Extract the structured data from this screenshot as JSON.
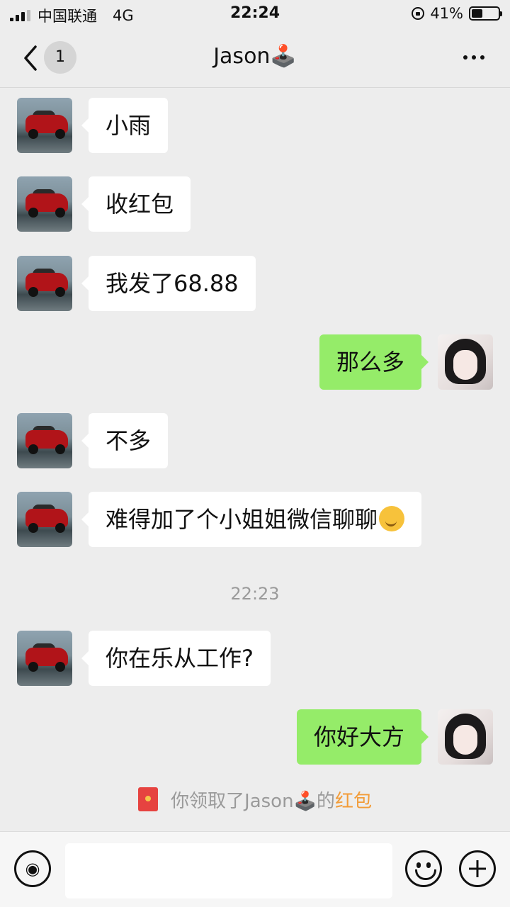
{
  "status_bar": {
    "carrier": "中国联通",
    "network": "4G",
    "time": "22:24",
    "battery": "41%",
    "battery_level": 0.41
  },
  "header": {
    "back_count": "1",
    "title": "Jason🕹️",
    "icons": {
      "back": "chevron-left-icon",
      "more": "more-icon"
    }
  },
  "messages": [
    {
      "side": "in",
      "text": "小雨"
    },
    {
      "side": "in",
      "text": "收红包"
    },
    {
      "side": "in",
      "text": "我发了68.88"
    },
    {
      "side": "out",
      "text": "那么多"
    },
    {
      "side": "in",
      "text": "不多"
    },
    {
      "side": "in",
      "text": "难得加了个小姐姐微信聊聊",
      "emoji": "thinking-face"
    },
    {
      "side": "in",
      "text": "你在乐从工作?"
    },
    {
      "side": "out",
      "text": "你好大方"
    }
  ],
  "timestamp": "22:23",
  "system_notice": {
    "prefix": "你领取了Jason🕹️的",
    "link": "红包"
  },
  "colors": {
    "incoming_bubble": "#ffffff",
    "outgoing_bubble": "#95ec69",
    "link": "#f29c38",
    "background": "#ededed"
  },
  "input_bar": {
    "icons": {
      "voice": "voice-icon",
      "emoji": "emoji-icon",
      "plus": "plus-icon"
    }
  }
}
